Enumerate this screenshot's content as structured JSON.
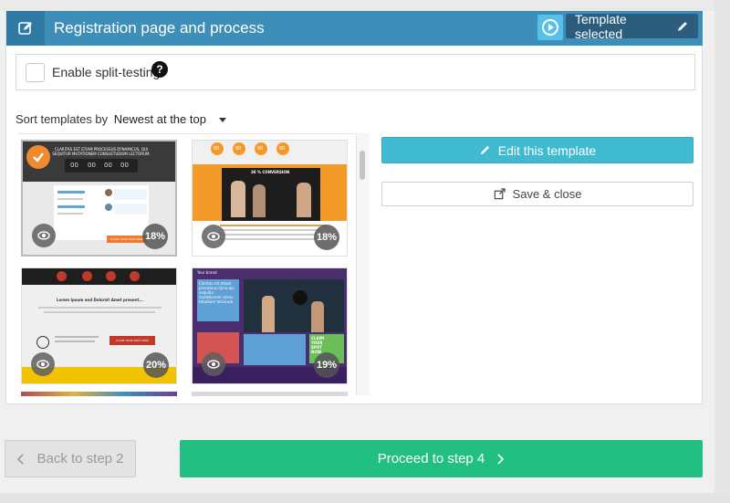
{
  "header": {
    "title": "Registration page and process",
    "template_selected_label": "Template selected"
  },
  "split_testing": {
    "label": "Enable split-testing",
    "checked": false,
    "help_glyph": "?"
  },
  "sort": {
    "label": "Sort templates by",
    "value": "Newest at the top"
  },
  "templates": [
    {
      "selected": true,
      "conversion": "18%",
      "headline": "CLARITAS EST ETIAM PROCESSUS DYNAMICUS, QUI SEQUITUR MUTATIONEM CONSUETUDIUM LECTORUM.",
      "countdown": [
        "00",
        "00",
        "00",
        "00"
      ],
      "cta": "CLAIM YOUR SPOT NOW"
    },
    {
      "selected": false,
      "conversion": "18%",
      "countdown": [
        "00",
        "00",
        "00",
        "00"
      ],
      "banner": "30 % CONVERSION"
    },
    {
      "selected": false,
      "conversion": "20%",
      "headline": "Lorem Ipsum and Dolorsit Amet present...",
      "cta": "CLAIM YOUR SPOT NOW"
    },
    {
      "selected": false,
      "conversion": "19%",
      "brand": "Your brand",
      "side_text": "Claritas est etiam processus dyna qui sequitur mutationem consu tetudium lectorum.",
      "cta": "CLAIM YOUR SPOT NOW"
    }
  ],
  "actions": {
    "edit_label": "Edit this template",
    "save_label": "Save & close"
  },
  "nav": {
    "back_label": "Back to step 2",
    "proceed_label": "Proceed to step 4"
  },
  "colors": {
    "header": "#3d8eb9",
    "header_dark": "#2c5d7d",
    "accent_blue": "#3fbad0",
    "proceed_green": "#21bf82",
    "selected_orange": "#f08a2e"
  },
  "icons": [
    "edit-icon",
    "play-circle-icon",
    "pencil-icon",
    "question-icon",
    "caret-down-icon",
    "eye-icon",
    "check-icon",
    "external-link-icon",
    "chevron-left-icon",
    "chevron-right-icon"
  ]
}
